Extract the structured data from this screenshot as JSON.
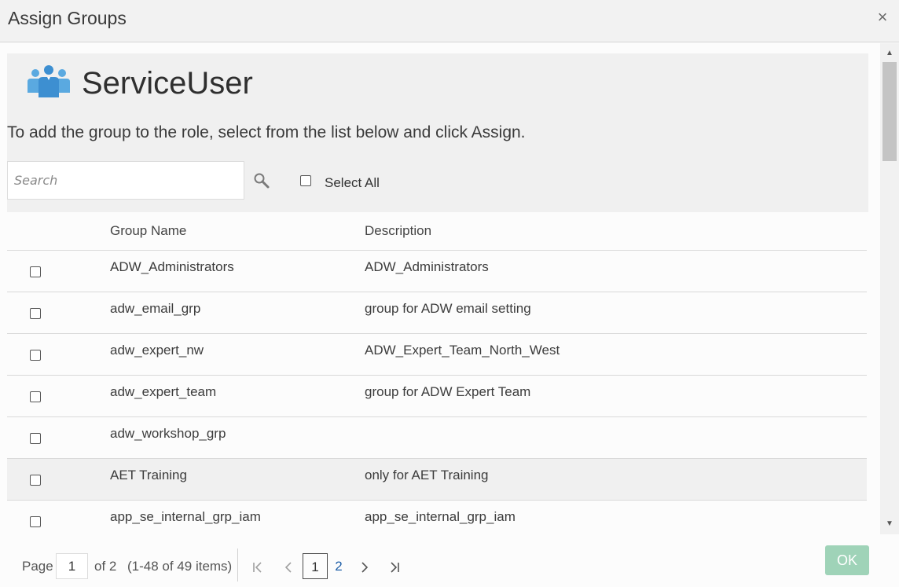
{
  "dialog": {
    "title": "Assign Groups",
    "close_label": "×"
  },
  "role": {
    "name": "ServiceUser",
    "icon": "users-group-icon"
  },
  "instructions": "To add the group to the role, select from the list below and click Assign.",
  "search": {
    "placeholder": "Search",
    "value": "",
    "icon": "search-icon"
  },
  "select_all": {
    "label": "Select All",
    "checked": false
  },
  "table": {
    "columns": [
      "Group Name",
      "Description"
    ],
    "rows": [
      {
        "name": "ADW_Administrators",
        "description": "ADW_Administrators",
        "checked": false
      },
      {
        "name": "adw_email_grp",
        "description": "group for ADW email setting",
        "checked": false
      },
      {
        "name": "adw_expert_nw",
        "description": "ADW_Expert_Team_North_West",
        "checked": false
      },
      {
        "name": "adw_expert_team",
        "description": "group for ADW Expert Team",
        "checked": false
      },
      {
        "name": "adw_workshop_grp",
        "description": "",
        "checked": false
      },
      {
        "name": "AET Training",
        "description": "only for AET Training",
        "checked": false
      },
      {
        "name": "app_se_internal_grp_iam",
        "description": "app_se_internal_grp_iam",
        "checked": false
      }
    ]
  },
  "pagination": {
    "page_label": "Page",
    "current_page": "1",
    "of_label": "of 2",
    "items_label": "(1-48 of 49 items)",
    "pages": [
      "1",
      "2"
    ],
    "first_icon": "first-page-icon",
    "prev_icon": "previous-page-icon",
    "next_icon": "next-page-icon",
    "last_icon": "last-page-icon"
  },
  "actions": {
    "ok_label": "OK"
  },
  "colors": {
    "ok_button": "#9fd3b8",
    "icon_blue": "#3d8fd1",
    "link": "#1f5fa8",
    "highlight_row": "#f0f0f0"
  }
}
